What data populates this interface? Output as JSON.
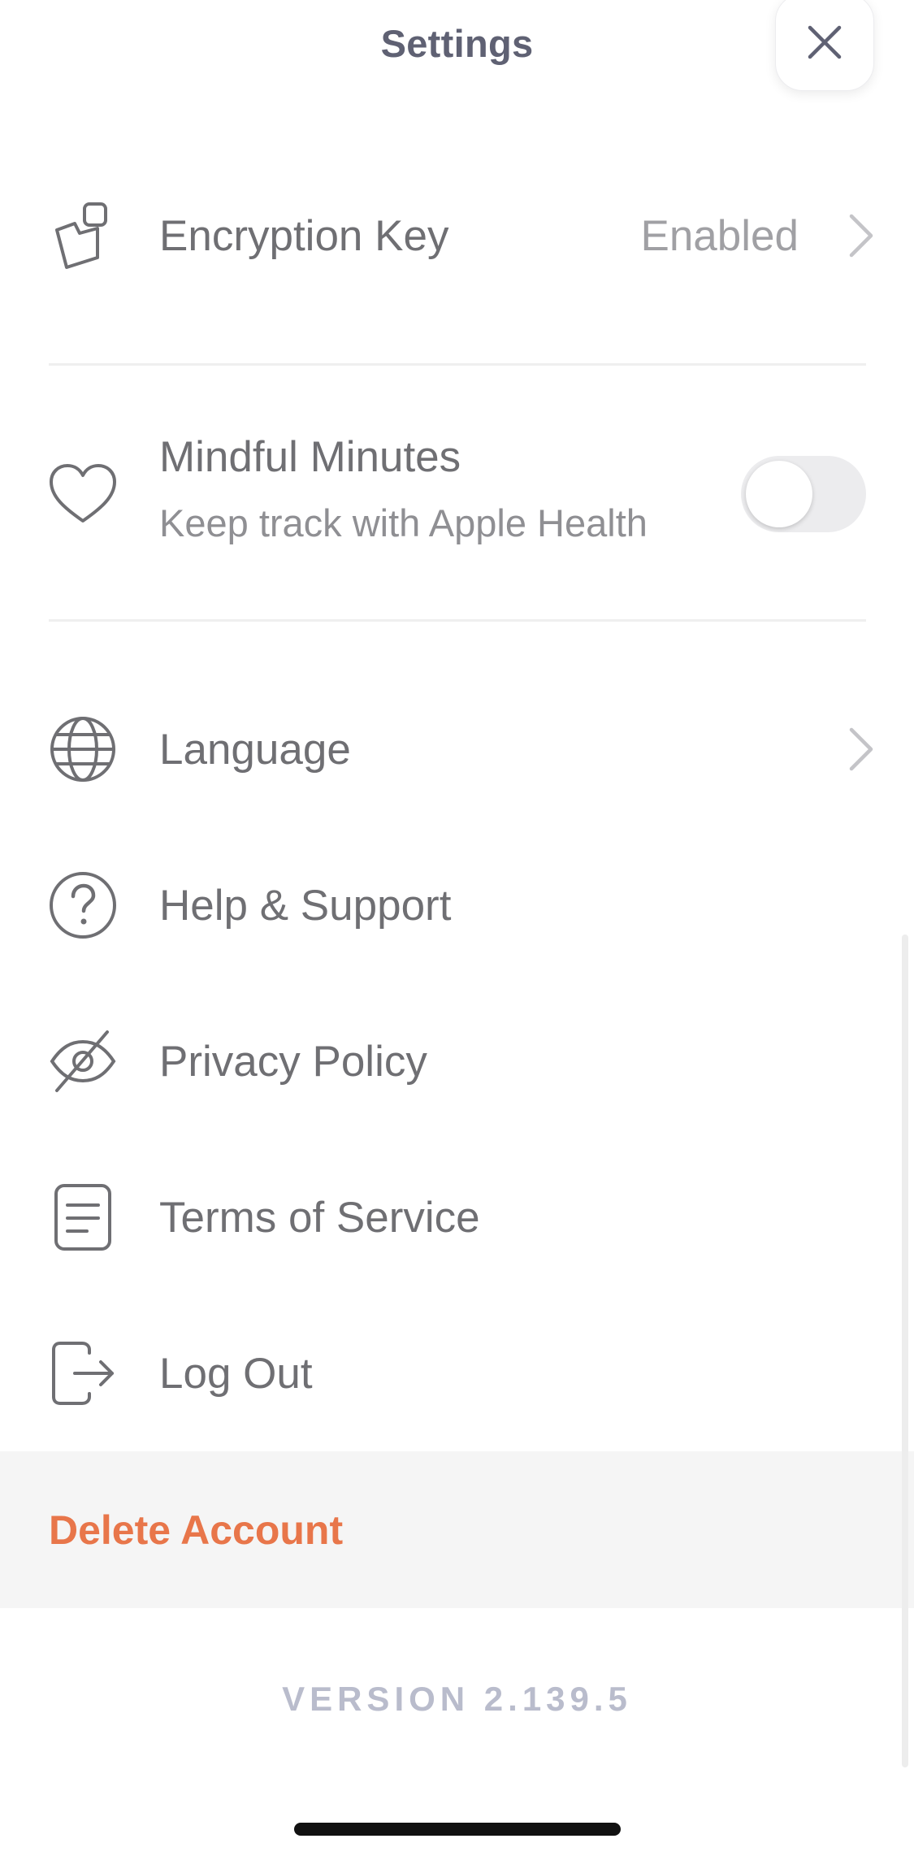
{
  "header": {
    "title": "Settings",
    "close_icon": "close-icon"
  },
  "rows": {
    "encryption": {
      "icon": "key-icon",
      "label": "Encryption Key",
      "value": "Enabled",
      "chevron": "chevron-right-icon"
    },
    "mindful": {
      "icon": "heart-icon",
      "label": "Mindful Minutes",
      "sublabel": "Keep track with Apple Health",
      "toggle_on": false
    },
    "language": {
      "icon": "globe-icon",
      "label": "Language",
      "chevron": "chevron-right-icon"
    },
    "help": {
      "icon": "question-circle-icon",
      "label": "Help & Support"
    },
    "privacy": {
      "icon": "eye-off-icon",
      "label": "Privacy Policy"
    },
    "terms": {
      "icon": "document-icon",
      "label": "Terms of Service"
    },
    "logout": {
      "icon": "logout-icon",
      "label": "Log Out"
    }
  },
  "delete_account": {
    "label": "Delete Account",
    "color": "#e8764a"
  },
  "version": "VERSION 2.139.5",
  "colors": {
    "title": "#5f6173",
    "label": "#6f6f73",
    "secondary": "#a0a0a4",
    "version": "#b9bccc"
  }
}
